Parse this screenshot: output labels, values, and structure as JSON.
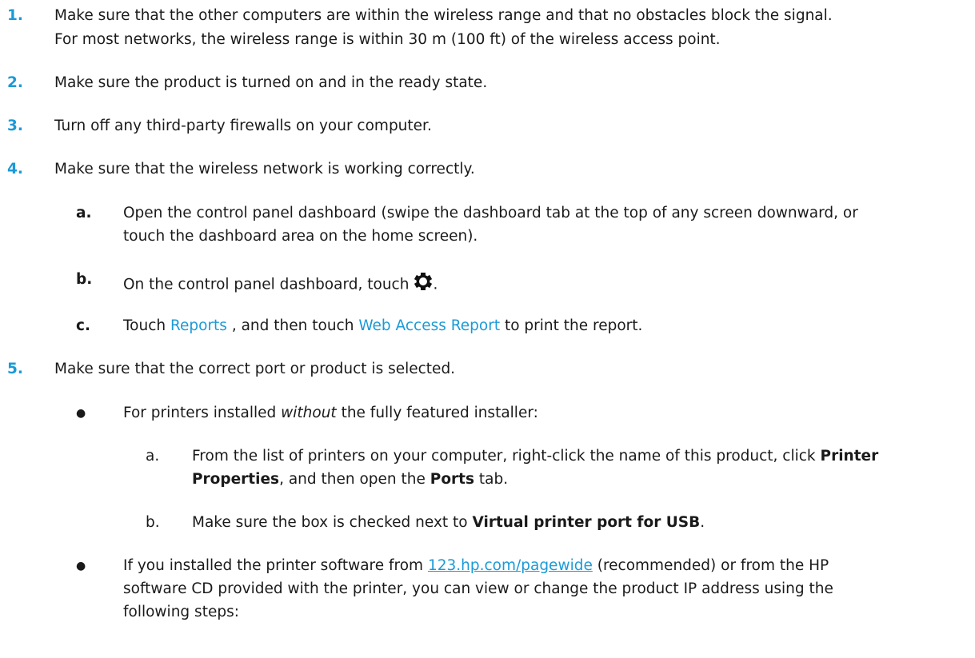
{
  "steps": [
    {
      "num": "1.",
      "line1": "Make sure that the other computers are within the wireless range and that no obstacles block the signal.",
      "line2": "For most networks, the wireless range is within 30 m (100 ft) of the wireless access point."
    },
    {
      "num": "2.",
      "text": "Make sure the product is turned on and in the ready state."
    },
    {
      "num": "3.",
      "text": "Turn off any third-party firewalls on your computer."
    },
    {
      "num": "4.",
      "text": "Make sure that the wireless network is working correctly.",
      "substeps": [
        {
          "label": "a.",
          "line1": "Open the control panel dashboard (swipe the dashboard tab at the top of any screen downward, or",
          "line2": "touch the dashboard area on the home screen)."
        },
        {
          "label": "b.",
          "text": "On the control panel dashboard, touch",
          "end": "."
        },
        {
          "label": "c.",
          "pre": "Touch ",
          "link1": "Reports",
          "mid": " , and then touch ",
          "link2": "Web Access Report",
          "post": " to print the report."
        }
      ]
    },
    {
      "num": "5.",
      "text": "Make sure that the correct port or product is selected.",
      "bullets": [
        {
          "pre": "For printers installed ",
          "em": "without",
          "post": " the fully featured installer:",
          "substeps": [
            {
              "label": "a.",
              "pre": "From the list of printers on your computer, right-click the name of this product, click ",
              "bold1": "Printer",
              "bold1b": "Properties",
              "mid": ", and then open the ",
              "bold2": "Ports",
              "post": " tab."
            },
            {
              "label": "b.",
              "pre": "Make sure the box is checked next to ",
              "bold": "Virtual printer port for USB",
              "post": "."
            }
          ]
        },
        {
          "pre": "If you installed the printer software from ",
          "link": "123.hp.com/pagewide",
          "mid": " (recommended) or from the HP",
          "line2": "software CD provided with the printer, you can view or change the product IP address using the",
          "line3": "following steps:"
        }
      ]
    }
  ]
}
